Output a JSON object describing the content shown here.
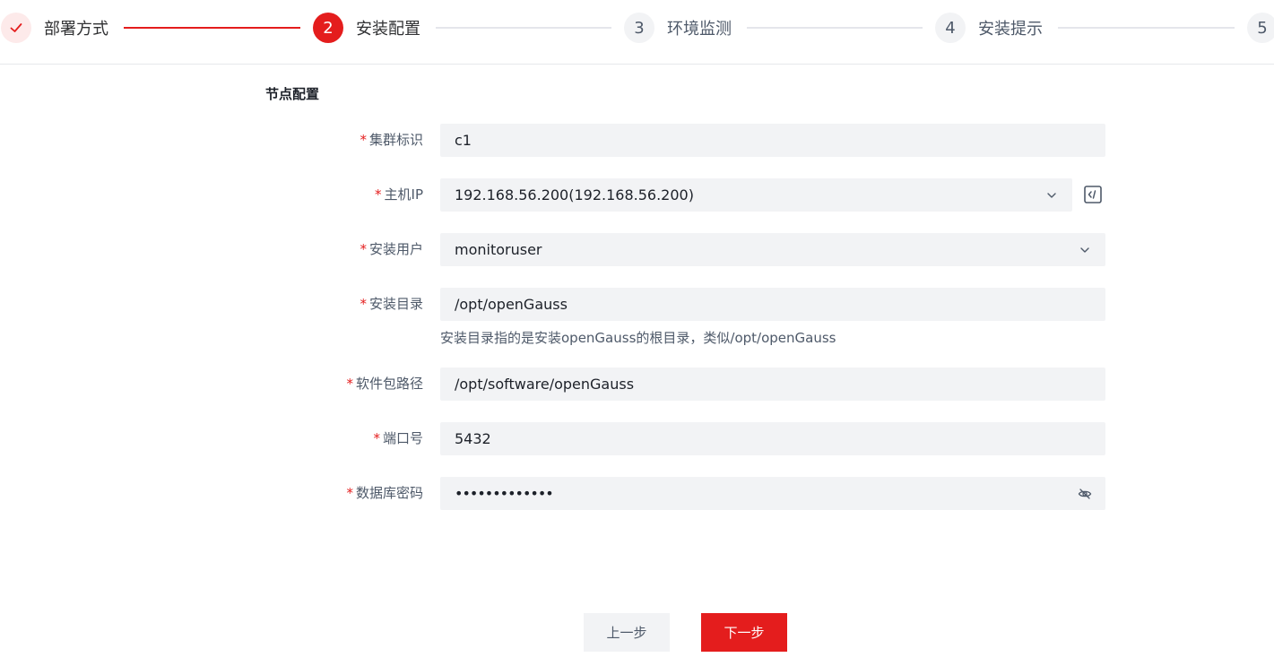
{
  "stepper": {
    "steps": [
      {
        "num": "✓",
        "label": "部署方式",
        "state": "done"
      },
      {
        "num": "2",
        "label": "安装配置",
        "state": "active"
      },
      {
        "num": "3",
        "label": "环境监测",
        "state": "todo"
      },
      {
        "num": "4",
        "label": "安装提示",
        "state": "todo"
      },
      {
        "num": "5",
        "label": "",
        "state": "todo"
      }
    ]
  },
  "section": {
    "title": "节点配置"
  },
  "form": {
    "required_mark": "*",
    "cluster_id": {
      "label": "集群标识",
      "value": "c1"
    },
    "host_ip": {
      "label": "主机IP",
      "value": "192.168.56.200(192.168.56.200)",
      "icon": "code-icon"
    },
    "install_user": {
      "label": "安装用户",
      "value": "monitoruser"
    },
    "install_dir": {
      "label": "安装目录",
      "value": "/opt/openGauss",
      "help": "安装目录指的是安装openGauss的根目录，类似/opt/openGauss"
    },
    "package_path": {
      "label": "软件包路径",
      "value": "/opt/software/openGauss"
    },
    "port": {
      "label": "端口号",
      "value": "5432"
    },
    "db_password": {
      "label": "数据库密码",
      "value": "•••••••••••••",
      "icon": "eye-off-icon"
    }
  },
  "buttons": {
    "prev": "上一步",
    "next": "下一步"
  },
  "colors": {
    "accent": "#e41d1d",
    "field_bg": "#f2f3f5",
    "line": "#e5e6eb"
  }
}
